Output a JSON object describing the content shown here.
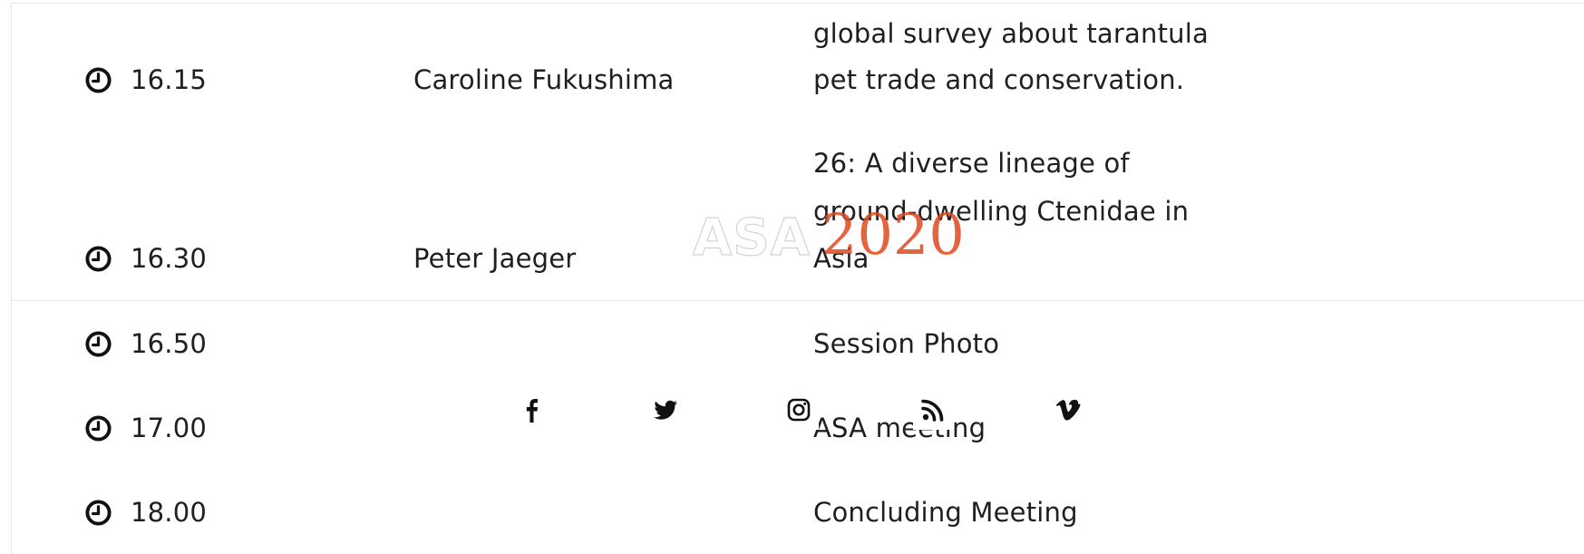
{
  "schedule": {
    "rows": [
      {
        "time": "16.15",
        "speaker": "Caroline Fukushima",
        "topic_lines": [
          "global survey about tarantula",
          "pet trade and conservation."
        ]
      },
      {
        "time": "16.30",
        "speaker": "Peter Jaeger",
        "topic_lines": [
          "26: A diverse lineage of",
          "ground-dwelling Ctenidae in",
          "Asia"
        ]
      },
      {
        "time": "16.50",
        "speaker": "",
        "topic_lines": [
          "Session Photo"
        ]
      },
      {
        "time": "17.00",
        "speaker": "",
        "topic_lines": [
          "ASA meeting"
        ]
      },
      {
        "time": "18.00",
        "speaker": "",
        "topic_lines": [
          "Concluding Meeting"
        ]
      }
    ]
  },
  "logo": {
    "text": "ASA",
    "year": "2020",
    "year_color": "#e0491e"
  },
  "social": {
    "icons": [
      "facebook-icon",
      "twitter-icon",
      "instagram-icon",
      "rss-icon",
      "vimeo-icon"
    ]
  },
  "colors": {
    "text": "#1f1f1f",
    "divider": "#e6e6e6"
  }
}
